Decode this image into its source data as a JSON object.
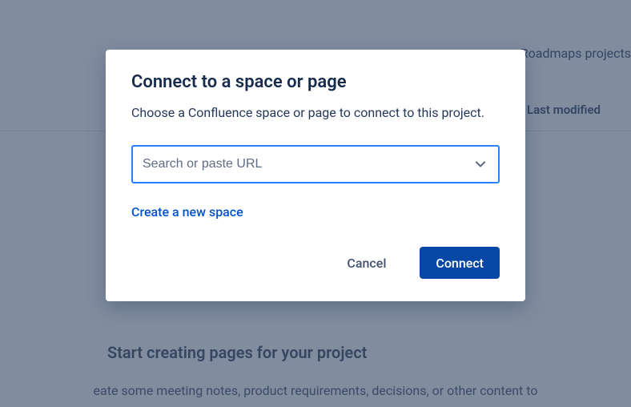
{
  "background": {
    "roadmaps_label": "Roadmaps projects",
    "last_modified": "Last modified",
    "start_title": "Start creating pages for your project",
    "start_subtitle": "eate some meeting notes, product requirements, decisions, or other content to"
  },
  "modal": {
    "title": "Connect to a space or page",
    "description": "Choose a Confluence space or page to connect to this project.",
    "search_placeholder": "Search or paste URL",
    "search_value": "",
    "create_link": "Create a new space",
    "cancel_label": "Cancel",
    "connect_label": "Connect"
  }
}
